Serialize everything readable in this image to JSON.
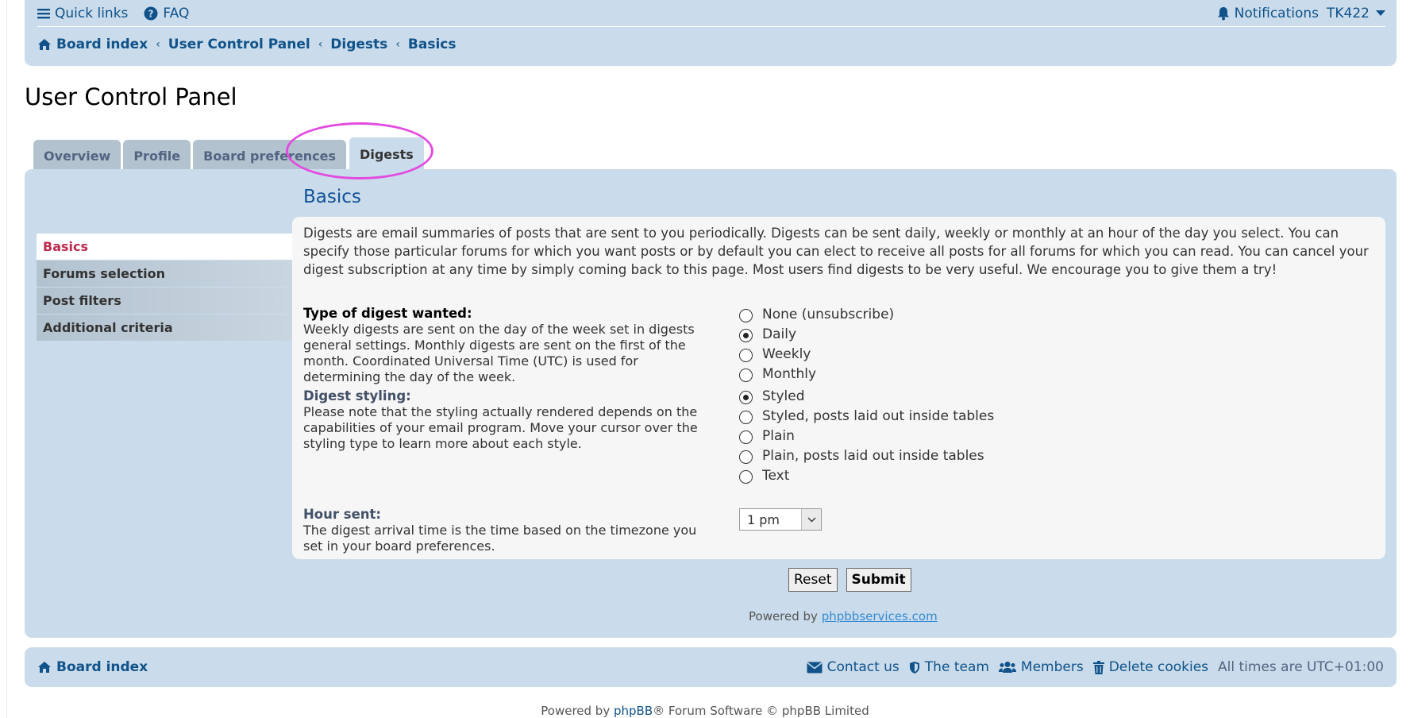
{
  "header": {
    "quick_links": "Quick links",
    "faq": "FAQ",
    "notifications": "Notifications",
    "username": "TK422"
  },
  "breadcrumbs": [
    "Board index",
    "User Control Panel",
    "Digests",
    "Basics"
  ],
  "page_title": "User Control Panel",
  "tabs": [
    {
      "label": "Overview",
      "active": false
    },
    {
      "label": "Profile",
      "active": false
    },
    {
      "label": "Board preferences",
      "active": false
    },
    {
      "label": "Digests",
      "active": true
    }
  ],
  "sidebar": {
    "items": [
      {
        "label": "Basics",
        "active": true
      },
      {
        "label": "Forums selection",
        "active": false
      },
      {
        "label": "Post filters",
        "active": false
      },
      {
        "label": "Additional criteria",
        "active": false
      }
    ]
  },
  "section_title": "Basics",
  "intro": "Digests are email summaries of posts that are sent to you periodically. Digests can be sent daily, weekly or monthly at an hour of the day you select. You can specify those particular forums for which you want posts or by default you can elect to receive all posts for all forums for which you can read. You can cancel your digest subscription at any time by simply coming back to this page. Most users find digests to be very useful. We encourage you to give them a try!",
  "digest_type": {
    "label": "Type of digest wanted:",
    "help": "Weekly digests are sent on the day of the week set in digests general settings. Monthly digests are sent on the first of the month. Coordinated Universal Time (UTC) is used for determining the day of the week.",
    "options": [
      "None (unsubscribe)",
      "Daily",
      "Weekly",
      "Monthly"
    ],
    "selected": "Daily"
  },
  "digest_styling": {
    "label": "Digest styling:",
    "help": "Please note that the styling actually rendered depends on the capabilities of your email program. Move your cursor over the styling type to learn more about each style.",
    "options": [
      "Styled",
      "Styled, posts laid out inside tables",
      "Plain",
      "Plain, posts laid out inside tables",
      "Text"
    ],
    "selected": "Styled"
  },
  "hour_sent": {
    "label": "Hour sent:",
    "help": "The digest arrival time is the time based on the timezone you set in your board preferences.",
    "value": "1 pm"
  },
  "buttons": {
    "reset": "Reset",
    "submit": "Submit"
  },
  "powered_inner": {
    "prefix": "Powered by",
    "link": "phpbbservices.com"
  },
  "footer": {
    "board_index": "Board index",
    "contact": "Contact us",
    "team": "The team",
    "members": "Members",
    "delete_cookies": "Delete cookies",
    "timezone": "All times are UTC+01:00"
  },
  "copyright": {
    "prefix": "Powered by",
    "link": "phpBB",
    "suffix": "® Forum Software © phpBB Limited"
  },
  "colors": {
    "accent": "#105289",
    "active_menu": "#bc2a4d",
    "panel": "#cadceb",
    "highlight": "#e24ce0"
  }
}
